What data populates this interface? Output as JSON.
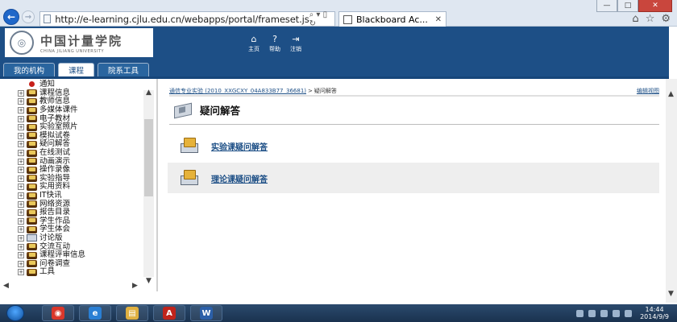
{
  "browser": {
    "url": "http://e-learning.cjlu.edu.cn/webapps/portal/frameset.js",
    "tab_title": "Blackboard Ac...",
    "addr_tools": "⌕ ▾ ▯ ↻",
    "tab_close": "✕",
    "win_min": "—",
    "win_max": "□",
    "win_close": "✕",
    "back_glyph": "←",
    "forward_glyph": "→"
  },
  "header": {
    "logo_cn": "中国计量学院",
    "logo_en": "CHINA JILIANG UNIVERSITY",
    "nav": [
      {
        "label": "主页",
        "icon": "home-icon",
        "glyph": "⌂"
      },
      {
        "label": "帮助",
        "icon": "help-icon",
        "glyph": "?"
      },
      {
        "label": "注销",
        "icon": "logout-icon",
        "glyph": "⇥"
      }
    ],
    "tabs": [
      {
        "label": "我的机构",
        "active": false
      },
      {
        "label": "课程",
        "active": true
      },
      {
        "label": "院系工具",
        "active": false
      }
    ]
  },
  "tree": {
    "items": [
      {
        "label": "通知",
        "icon": "pin",
        "expandable": false
      },
      {
        "label": "课程信息",
        "icon": "folder",
        "expandable": true
      },
      {
        "label": "教师信息",
        "icon": "folder",
        "expandable": true
      },
      {
        "label": "多媒体课件",
        "icon": "folder",
        "expandable": true
      },
      {
        "label": "电子教材",
        "icon": "folder",
        "expandable": true
      },
      {
        "label": "实验室照片",
        "icon": "folder",
        "expandable": true
      },
      {
        "label": "模拟试卷",
        "icon": "folder",
        "expandable": true
      },
      {
        "label": "疑问解答",
        "icon": "folder",
        "expandable": true
      },
      {
        "label": "在线测试",
        "icon": "folder",
        "expandable": true
      },
      {
        "label": "动画演示",
        "icon": "folder",
        "expandable": true
      },
      {
        "label": "操作录像",
        "icon": "folder",
        "expandable": true
      },
      {
        "label": "实验指导",
        "icon": "folder",
        "expandable": true
      },
      {
        "label": "实用资料",
        "icon": "folder",
        "expandable": true
      },
      {
        "label": "IT快讯",
        "icon": "folder",
        "expandable": true
      },
      {
        "label": "网络资源",
        "icon": "folder",
        "expandable": true
      },
      {
        "label": "报告目录",
        "icon": "folder",
        "expandable": true
      },
      {
        "label": "学生作品",
        "icon": "folder",
        "expandable": true
      },
      {
        "label": "学生体会",
        "icon": "folder",
        "expandable": true
      },
      {
        "label": "讨论版",
        "icon": "board",
        "expandable": true
      },
      {
        "label": "交流互动",
        "icon": "folder",
        "expandable": true
      },
      {
        "label": "课程评审信息",
        "icon": "folder",
        "expandable": true
      },
      {
        "label": "问卷调查",
        "icon": "folder",
        "expandable": true
      },
      {
        "label": "工具",
        "icon": "folder",
        "expandable": true
      }
    ]
  },
  "content": {
    "breadcrumb": {
      "link": "通信专业实验 (2010_XXGCXY_04A833B77_36681)",
      "separator": ">",
      "current": "疑问解答"
    },
    "edit_view": "编辑视图",
    "page_title": "疑问解答",
    "items": [
      {
        "label": "实验课疑问解答"
      },
      {
        "label": "理论课疑问解答"
      }
    ]
  },
  "taskbar": {
    "time": "14:44",
    "date": "2014/9/9",
    "apps": [
      {
        "name": "chrome",
        "glyph": "◉",
        "color": "#d9372b"
      },
      {
        "name": "internet-explorer",
        "glyph": "e",
        "color": "#2a7fd4"
      },
      {
        "name": "file-explorer",
        "glyph": "▤",
        "color": "#e0b040"
      },
      {
        "name": "pdf-reader",
        "glyph": "A",
        "color": "#c0241c"
      },
      {
        "name": "word",
        "glyph": "W",
        "color": "#2b5fa8"
      }
    ]
  }
}
